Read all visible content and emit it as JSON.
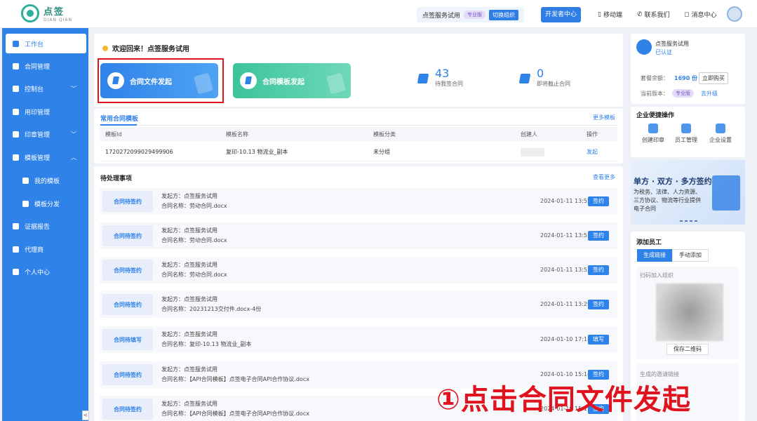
{
  "app": {
    "logo_name": "点签",
    "logo_sub": "DIAN QIAN"
  },
  "header": {
    "org_name": "点签服务试用",
    "vip_badge": "专业版",
    "switch_label": "切换组织",
    "open_label": "开发者中心",
    "nav": [
      "移动端",
      "联系我们",
      "消息中心"
    ]
  },
  "sidebar": {
    "items": [
      {
        "label": "工作台"
      },
      {
        "label": "合同管理"
      },
      {
        "label": "控制台"
      },
      {
        "label": "用印管理"
      },
      {
        "label": "印章管理"
      },
      {
        "label": "模板管理"
      },
      {
        "label": "我的模板"
      },
      {
        "label": "模板分发"
      },
      {
        "label": "证据报告"
      },
      {
        "label": "代理商"
      },
      {
        "label": "个人中心"
      }
    ],
    "collapse_label": "<"
  },
  "welcome": {
    "text": "欢迎回来！点签服务试用"
  },
  "actions": {
    "contract_launch": "合同文件发起",
    "template_launch": "合同模板发起"
  },
  "stats": {
    "pending_value": "43",
    "pending_label": "待我签合同",
    "expiring_value": "0",
    "expiring_label": "即将截止合同"
  },
  "templates": {
    "title": "常用合同模板",
    "more": "更多模板",
    "headers": [
      "模板Id",
      "模板名称",
      "模板分类",
      "创建人",
      "操作"
    ],
    "rows": [
      {
        "id": "1720272099029499906",
        "name": "复印-10.13 物流业_副本",
        "category": "未分组",
        "creator": "",
        "action": "发起"
      }
    ]
  },
  "todos": {
    "title": "待处理事项",
    "more": "查看更多",
    "items": [
      {
        "status": "合同待签约",
        "sender": "发起方：点签服务试用",
        "name": "合同名称：劳动合同.docx",
        "time": "2024-01-11 13:55",
        "action": "签约"
      },
      {
        "status": "合同待签约",
        "sender": "发起方：点签服务试用",
        "name": "合同名称：劳动合同.docx",
        "time": "2024-01-11 13:53",
        "action": "签约"
      },
      {
        "status": "合同待签约",
        "sender": "发起方：点签服务试用",
        "name": "合同名称：劳动合同.docx",
        "time": "2024-01-11 13:52",
        "action": "签约"
      },
      {
        "status": "合同待签约",
        "sender": "发起方：点签服务试用",
        "name": "合同名称：20231213交付件.docx-4份",
        "time": "2024-01-11 13:29",
        "action": "签约"
      },
      {
        "status": "合同待填写",
        "sender": "发起方：点签服务试用",
        "name": "合同名称：复印-10.13 物流业_副本",
        "time": "2024-01-10 17:18",
        "action": "填写"
      },
      {
        "status": "合同待签约",
        "sender": "发起方：点签服务试用",
        "name": "合同名称：【API合同模板】点签电子合同API合作协议.docx",
        "time": "2024-01-10 15:14",
        "action": "签约"
      },
      {
        "status": "合同待签约",
        "sender": "发起方：点签服务试用",
        "name": "合同名称：【API合同模板】点签电子合同API合作协议.docx",
        "time": "2024-01-10 15:1",
        "action": "签约"
      }
    ]
  },
  "account": {
    "name": "点签服务试用",
    "verified": "已认证",
    "balance_label": "套餐余额：",
    "balance_value": "1690 份",
    "buy": "立即购买",
    "version_label": "当前版本：",
    "version_badge": "专业版",
    "upgrade": "去升级"
  },
  "quick_ops": {
    "title": "企业便捷操作",
    "items": [
      "创建印章",
      "员工管理",
      "企业设置"
    ]
  },
  "banner": {
    "title": "单方 · 双方 · 多方签约",
    "text": "为税务、法律、人力资源、三方协议、物流等行业提供电子合同"
  },
  "add_staff": {
    "title": "添加员工",
    "tab_active": "生成链接",
    "tab_other": "手动添加",
    "qr_label": "扫码加入组织",
    "save": "保存二维码",
    "link_label": "生成的邀请链接"
  },
  "overlay": {
    "text": "①点击合同文件发起"
  }
}
